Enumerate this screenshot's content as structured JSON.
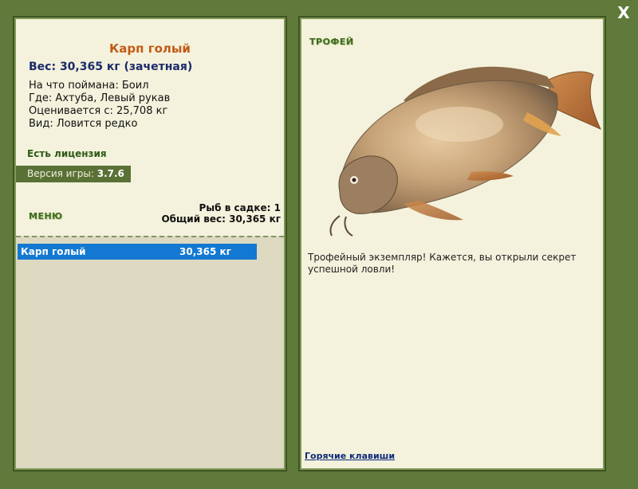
{
  "fish": {
    "name": "Карп голый",
    "weight_line": "Вес: 30,365 кг (зачетная)",
    "info": [
      "На что поймана: Боил",
      "Где: Ахтуба, Левый рукав",
      "Оценивается с: 25,708 кг",
      "Вид: Ловится редко"
    ]
  },
  "license": "Есть лицензия",
  "version": {
    "label": "Версия игры:",
    "value": "3.7.6"
  },
  "menu_label": "МЕНЮ",
  "keepnet": {
    "count_line": "Рыб в садке: 1",
    "total_line": "Общий вес: 30,365 кг",
    "rows": [
      {
        "name": "Карп голый",
        "weight": "30,365 кг"
      }
    ]
  },
  "trophy": {
    "label": "ТРОФЕЙ",
    "text": "Трофейный экземпляр! Кажется, вы открыли секрет успешной ловли!"
  },
  "hotkeys_link": "Горячие клавиши",
  "close_icon": "X",
  "colors": {
    "background": "#5f7a3a",
    "panel": "#f4f2dc",
    "title": "#c35a17",
    "weight": "#1b2a6b",
    "selection": "#1278d2",
    "version_box": "#5a7136"
  }
}
